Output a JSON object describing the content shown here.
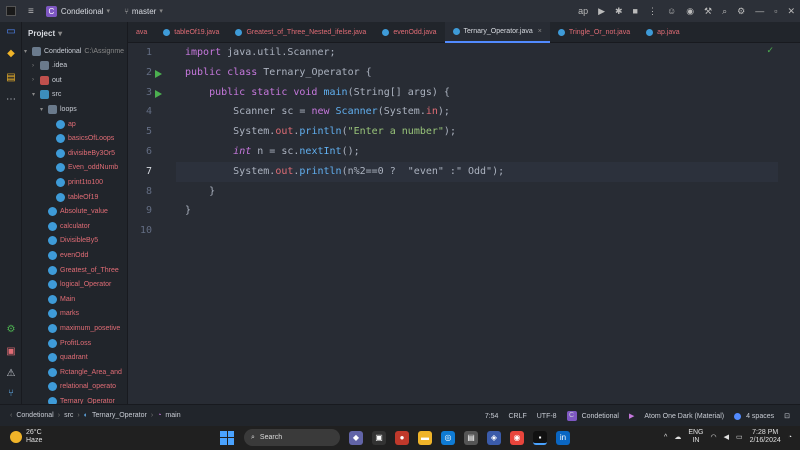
{
  "titlebar": {
    "project_badge": "C",
    "project_name": "Condetional",
    "branch": "master",
    "run_config": "ap"
  },
  "project_panel": {
    "title": "Project",
    "tree": [
      {
        "label": "Condetional",
        "sub": "C:\\Assignme",
        "icon": "folder",
        "depth": 0,
        "arrow": "▾",
        "red": false
      },
      {
        "label": ".idea",
        "icon": "folder",
        "depth": 1,
        "arrow": "›",
        "red": false
      },
      {
        "label": "out",
        "icon": "folder-red",
        "depth": 1,
        "arrow": "›",
        "red": false
      },
      {
        "label": "src",
        "icon": "folder-blue",
        "depth": 1,
        "arrow": "▾",
        "red": false
      },
      {
        "label": "loops",
        "icon": "folder",
        "depth": 2,
        "arrow": "▾",
        "red": false
      },
      {
        "label": "ap",
        "icon": "java",
        "depth": 3,
        "arrow": "",
        "red": true
      },
      {
        "label": "basicsOfLoops",
        "icon": "java",
        "depth": 3,
        "arrow": "",
        "red": true
      },
      {
        "label": "divisibeBy3Or5",
        "icon": "java",
        "depth": 3,
        "arrow": "",
        "red": true
      },
      {
        "label": "Even_oddNumb",
        "icon": "java",
        "depth": 3,
        "arrow": "",
        "red": true
      },
      {
        "label": "print1to100",
        "icon": "java",
        "depth": 3,
        "arrow": "",
        "red": true
      },
      {
        "label": "tableOf19",
        "icon": "java",
        "depth": 3,
        "arrow": "",
        "red": true
      },
      {
        "label": "Absolute_value",
        "icon": "java",
        "depth": 2,
        "arrow": "",
        "red": true
      },
      {
        "label": "calculator",
        "icon": "java",
        "depth": 2,
        "arrow": "",
        "red": true
      },
      {
        "label": "DivisibleBy5",
        "icon": "java",
        "depth": 2,
        "arrow": "",
        "red": true
      },
      {
        "label": "evenOdd",
        "icon": "java",
        "depth": 2,
        "arrow": "",
        "red": true
      },
      {
        "label": "Greatest_of_Three",
        "icon": "java",
        "depth": 2,
        "arrow": "",
        "red": true
      },
      {
        "label": "logical_Operator",
        "icon": "java",
        "depth": 2,
        "arrow": "",
        "red": true
      },
      {
        "label": "Main",
        "icon": "java",
        "depth": 2,
        "arrow": "",
        "red": true
      },
      {
        "label": "marks",
        "icon": "java",
        "depth": 2,
        "arrow": "",
        "red": true
      },
      {
        "label": "maximum_posetive",
        "icon": "java",
        "depth": 2,
        "arrow": "",
        "red": true
      },
      {
        "label": "ProfitLoss",
        "icon": "java",
        "depth": 2,
        "arrow": "",
        "red": true
      },
      {
        "label": "quadrant",
        "icon": "java",
        "depth": 2,
        "arrow": "",
        "red": true
      },
      {
        "label": "Rctangle_Area_and",
        "icon": "java",
        "depth": 2,
        "arrow": "",
        "red": true
      },
      {
        "label": "relational_operato",
        "icon": "java",
        "depth": 2,
        "arrow": "",
        "red": true
      },
      {
        "label": "Ternary_Operator",
        "icon": "java",
        "depth": 2,
        "arrow": "",
        "red": true
      }
    ]
  },
  "tabs": [
    {
      "label": "ava",
      "red": true,
      "active": false,
      "icon": false
    },
    {
      "label": "tableOf19.java",
      "red": true,
      "active": false,
      "icon": true
    },
    {
      "label": "Greatest_of_Three_Nested_ifelse.java",
      "red": true,
      "active": false,
      "icon": true
    },
    {
      "label": "evenOdd.java",
      "red": true,
      "active": false,
      "icon": true
    },
    {
      "label": "Ternary_Operator.java",
      "red": false,
      "active": true,
      "icon": true
    },
    {
      "label": "Tringle_Or_not.java",
      "red": true,
      "active": false,
      "icon": true
    },
    {
      "label": "ap.java",
      "red": true,
      "active": false,
      "icon": true
    }
  ],
  "editor": {
    "line_numbers": [
      "1",
      "2",
      "3",
      "4",
      "5",
      "6",
      "7",
      "8",
      "9",
      "10"
    ],
    "current_line": 7,
    "run_marks": [
      2,
      3
    ],
    "code": [
      [
        {
          "t": "import ",
          "c": "kw"
        },
        {
          "t": "java.util.Scanner;",
          "c": ""
        }
      ],
      [
        {
          "t": "public class ",
          "c": "kw"
        },
        {
          "t": "Ternary_Operator {",
          "c": ""
        }
      ],
      [
        {
          "t": "    public static void ",
          "c": "kw"
        },
        {
          "t": "main",
          "c": "fn"
        },
        {
          "t": "(String[] args) {",
          "c": ""
        }
      ],
      [
        {
          "t": "        Scanner sc = ",
          "c": ""
        },
        {
          "t": "new ",
          "c": "kw"
        },
        {
          "t": "Scanner",
          "c": "fn"
        },
        {
          "t": "(System.",
          "c": ""
        },
        {
          "t": "in",
          "c": "field"
        },
        {
          "t": ");",
          "c": ""
        }
      ],
      [
        {
          "t": "        System.",
          "c": ""
        },
        {
          "t": "out",
          "c": "field"
        },
        {
          "t": ".",
          "c": ""
        },
        {
          "t": "println",
          "c": "fn"
        },
        {
          "t": "(",
          "c": ""
        },
        {
          "t": "\"Enter a number\"",
          "c": "str"
        },
        {
          "t": ");",
          "c": ""
        }
      ],
      [
        {
          "t": "        ",
          "c": ""
        },
        {
          "t": "int",
          "c": "kwi"
        },
        {
          "t": " n = sc.",
          "c": ""
        },
        {
          "t": "nextInt",
          "c": "fn"
        },
        {
          "t": "();",
          "c": ""
        }
      ],
      [
        {
          "t": "        System.",
          "c": ""
        },
        {
          "t": "out",
          "c": "field"
        },
        {
          "t": ".",
          "c": ""
        },
        {
          "t": "println",
          "c": "fn"
        },
        {
          "t": "(n%2==0 ?  \"even\" :\" Odd\");",
          "c": ""
        }
      ],
      [
        {
          "t": "    }",
          "c": ""
        }
      ],
      [
        {
          "t": "}",
          "c": ""
        }
      ],
      [
        {
          "t": "",
          "c": ""
        }
      ]
    ]
  },
  "statusbar": {
    "crumbs": [
      "Condetional",
      "src",
      "Ternary_Operator",
      "main"
    ],
    "position": "7:54",
    "line_sep": "CRLF",
    "encoding": "UTF-8",
    "badge": "C",
    "context": "Condetional",
    "theme": "Atom One Dark (Material)",
    "indent": "4 spaces"
  },
  "taskbar": {
    "temp": "26°C",
    "weather": "Haze",
    "search_placeholder": "Search",
    "lang": "ENG",
    "region": "IN",
    "time": "7:28 PM",
    "date": "2/16/2024"
  }
}
